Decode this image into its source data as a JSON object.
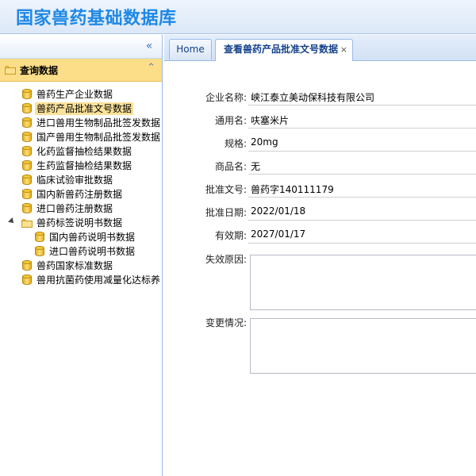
{
  "header": {
    "title": "国家兽药基础数据库"
  },
  "sidebar": {
    "collapse_icon": "double-chevron-left-icon",
    "panel_title": "查询数据",
    "panel_collapse_icon": "double-chevron-up-icon",
    "items": [
      {
        "label": "兽药生产企业数据",
        "icon": "database-icon",
        "level": 1,
        "selected": false
      },
      {
        "label": "兽药产品批准文号数据",
        "icon": "database-icon",
        "level": 1,
        "selected": true
      },
      {
        "label": "进口兽用生物制品批签发数据",
        "icon": "database-icon",
        "level": 1,
        "selected": false
      },
      {
        "label": "国产兽用生物制品批签发数据",
        "icon": "database-icon",
        "level": 1,
        "selected": false
      },
      {
        "label": "化药监督抽检结果数据",
        "icon": "database-icon",
        "level": 1,
        "selected": false
      },
      {
        "label": "生药监督抽检结果数据",
        "icon": "database-icon",
        "level": 1,
        "selected": false
      },
      {
        "label": "临床试验审批数据",
        "icon": "database-icon",
        "level": 1,
        "selected": false
      },
      {
        "label": "国内新兽药注册数据",
        "icon": "database-icon",
        "level": 1,
        "selected": false
      },
      {
        "label": "进口兽药注册数据",
        "icon": "database-icon",
        "level": 1,
        "selected": false
      },
      {
        "label": "兽药标签说明书数据",
        "icon": "folder-open-icon",
        "level": 1,
        "expanded": true,
        "selected": false
      },
      {
        "label": "国内兽药说明书数据",
        "icon": "database-icon",
        "level": 2,
        "selected": false
      },
      {
        "label": "进口兽药说明书数据",
        "icon": "database-icon",
        "level": 2,
        "selected": false
      },
      {
        "label": "兽药国家标准数据",
        "icon": "database-icon",
        "level": 1,
        "selected": false
      },
      {
        "label": "兽用抗菌药使用减量化达标养",
        "icon": "database-icon",
        "level": 1,
        "selected": false
      }
    ]
  },
  "tabs": [
    {
      "label": "Home",
      "active": false
    },
    {
      "label": "查看兽药产品批准文号数据",
      "active": true,
      "close": "×"
    }
  ],
  "form": {
    "fields": [
      {
        "label": "企业名称:",
        "value": "峡江泰立美动保科技有限公司"
      },
      {
        "label": "通用名:",
        "value": "呋塞米片"
      },
      {
        "label": "规格:",
        "value": "20mg"
      },
      {
        "label": "商品名:",
        "value": "无"
      },
      {
        "label": "批准文号:",
        "value": "兽药字140111179"
      },
      {
        "label": "批准日期:",
        "value": "2022/01/18"
      },
      {
        "label": "有效期:",
        "value": "2027/01/17"
      }
    ],
    "textareas": [
      {
        "label": "失效原因:",
        "value": ""
      },
      {
        "label": "变更情况:",
        "value": ""
      }
    ]
  },
  "colors": {
    "accent": "#1e88e5",
    "selected": "#fbe29a",
    "panel_header": "#fcdd88",
    "border": "#99bbe8"
  }
}
